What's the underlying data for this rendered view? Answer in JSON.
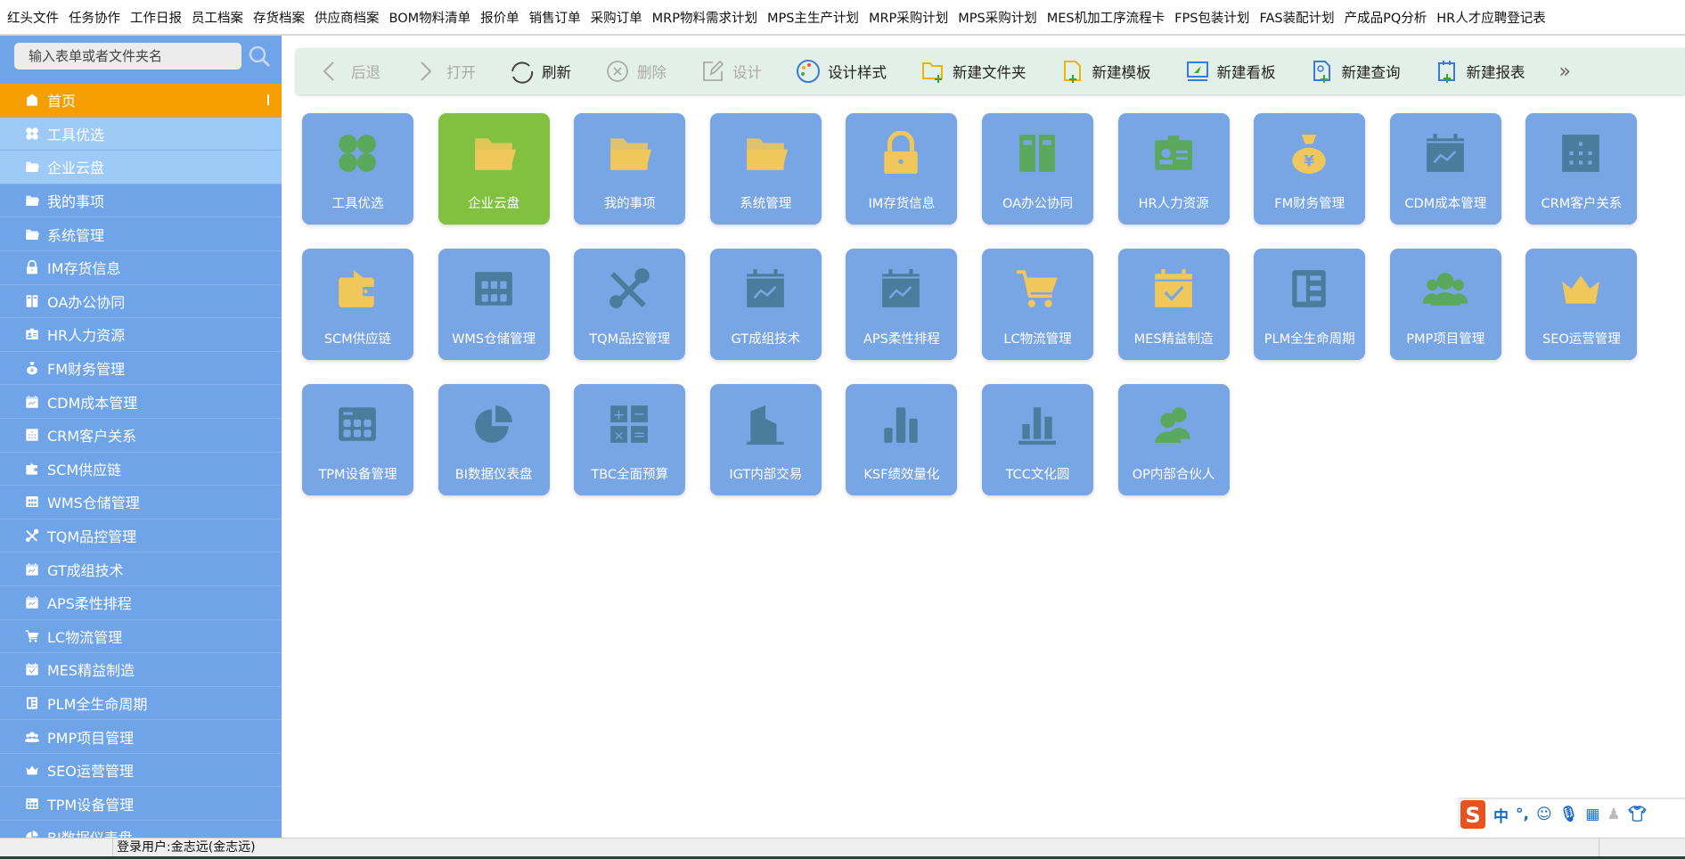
{
  "top_menu": [
    "红头文件",
    "任务协作",
    "工作日报",
    "员工档案",
    "存货档案",
    "供应商档案",
    "BOM物料清单",
    "报价单",
    "销售订单",
    "采购订单",
    "MRP物料需求计划",
    "MPS主生产计划",
    "MRP采购计划",
    "MPS采购计划",
    "MES机加工序流程卡",
    "FPS包装计划",
    "FAS装配计划",
    "产成品PQ分析",
    "HR人才应聘登记表"
  ],
  "sidebar": {
    "search_placeholder": "输入表单或者文件夹名",
    "items": [
      {
        "label": "首页",
        "icon": "home",
        "state": "active"
      },
      {
        "label": "工具优选",
        "icon": "clover",
        "state": "light"
      },
      {
        "label": "企业云盘",
        "icon": "folder",
        "state": "light"
      },
      {
        "label": "我的事项",
        "icon": "folder"
      },
      {
        "label": "系统管理",
        "icon": "folder"
      },
      {
        "label": "IM存货信息",
        "icon": "lock"
      },
      {
        "label": "OA办公协同",
        "icon": "binder"
      },
      {
        "label": "HR人力资源",
        "icon": "idcard"
      },
      {
        "label": "FM财务管理",
        "icon": "moneybag"
      },
      {
        "label": "CDM成本管理",
        "icon": "calendar-chart"
      },
      {
        "label": "CRM客户关系",
        "icon": "grid-box"
      },
      {
        "label": "SCM供应链",
        "icon": "wallet"
      },
      {
        "label": "WMS仓储管理",
        "icon": "keypad"
      },
      {
        "label": "TQM品控管理",
        "icon": "tools"
      },
      {
        "label": "GT成组技术",
        "icon": "calendar-chart"
      },
      {
        "label": "APS柔性排程",
        "icon": "calendar-chart"
      },
      {
        "label": "LC物流管理",
        "icon": "cart"
      },
      {
        "label": "MES精益制造",
        "icon": "calendar-check"
      },
      {
        "label": "PLM全生命周期",
        "icon": "layout"
      },
      {
        "label": "PMP项目管理",
        "icon": "users"
      },
      {
        "label": "SEO运营管理",
        "icon": "crown"
      },
      {
        "label": "TPM设备管理",
        "icon": "calculator"
      },
      {
        "label": "BI数据仪表盘",
        "icon": "pie"
      }
    ]
  },
  "toolbar": [
    {
      "label": "后退",
      "icon": "chevron-left",
      "disabled": true
    },
    {
      "label": "打开",
      "icon": "chevron-right",
      "disabled": true
    },
    {
      "label": "刷新",
      "icon": "refresh",
      "disabled": false
    },
    {
      "label": "删除",
      "icon": "delete-circle",
      "disabled": true
    },
    {
      "label": "设计",
      "icon": "edit",
      "disabled": true
    },
    {
      "label": "设计样式",
      "icon": "palette",
      "disabled": false
    },
    {
      "label": "新建文件夹",
      "icon": "new-folder",
      "disabled": false
    },
    {
      "label": "新建模板",
      "icon": "new-template",
      "disabled": false
    },
    {
      "label": "新建看板",
      "icon": "new-board",
      "disabled": false
    },
    {
      "label": "新建查询",
      "icon": "new-query",
      "disabled": false
    },
    {
      "label": "新建报表",
      "icon": "new-report",
      "disabled": false
    },
    {
      "label": "»",
      "icon": "more",
      "disabled": false
    }
  ],
  "tiles": [
    {
      "label": "工具优选",
      "icon": "clover"
    },
    {
      "label": "企业云盘",
      "icon": "folder",
      "selected": true
    },
    {
      "label": "我的事项",
      "icon": "folder"
    },
    {
      "label": "系统管理",
      "icon": "folder"
    },
    {
      "label": "IM存货信息",
      "icon": "lock"
    },
    {
      "label": "OA办公协同",
      "icon": "binder"
    },
    {
      "label": "HR人力资源",
      "icon": "idcard"
    },
    {
      "label": "FM财务管理",
      "icon": "moneybag"
    },
    {
      "label": "CDM成本管理",
      "icon": "calendar-chart"
    },
    {
      "label": "CRM客户关系",
      "icon": "grid-box"
    },
    {
      "label": "SCM供应链",
      "icon": "wallet"
    },
    {
      "label": "WMS仓储管理",
      "icon": "keypad"
    },
    {
      "label": "TQM品控管理",
      "icon": "tools"
    },
    {
      "label": "GT成组技术",
      "icon": "calendar-chart"
    },
    {
      "label": "APS柔性排程",
      "icon": "calendar-chart"
    },
    {
      "label": "LC物流管理",
      "icon": "cart"
    },
    {
      "label": "MES精益制造",
      "icon": "calendar-check"
    },
    {
      "label": "PLM全生命周期",
      "icon": "layout"
    },
    {
      "label": "PMP项目管理",
      "icon": "users"
    },
    {
      "label": "SEO运营管理",
      "icon": "crown"
    },
    {
      "label": "TPM设备管理",
      "icon": "calculator"
    },
    {
      "label": "BI数据仪表盘",
      "icon": "pie"
    },
    {
      "label": "TBC全面预算",
      "icon": "math"
    },
    {
      "label": "IGT内部交易",
      "icon": "building"
    },
    {
      "label": "KSF绩效量化",
      "icon": "bar-chart"
    },
    {
      "label": "TCC文化圆",
      "icon": "podium"
    },
    {
      "label": "OP内部合伙人",
      "icon": "partners"
    }
  ],
  "status": {
    "user": "登录用户:金志远(金志远)"
  },
  "ime": {
    "lang": "中",
    "punct": "°,"
  },
  "colors": {
    "sidebar": "#6fa4e9",
    "active": "#f79f00",
    "tile": "#78a5e4",
    "tile_selected": "#81c13f",
    "icon_dark": "#4a7c9e",
    "icon_yellow": "#f0c75a",
    "icon_green": "#5aa85c"
  }
}
